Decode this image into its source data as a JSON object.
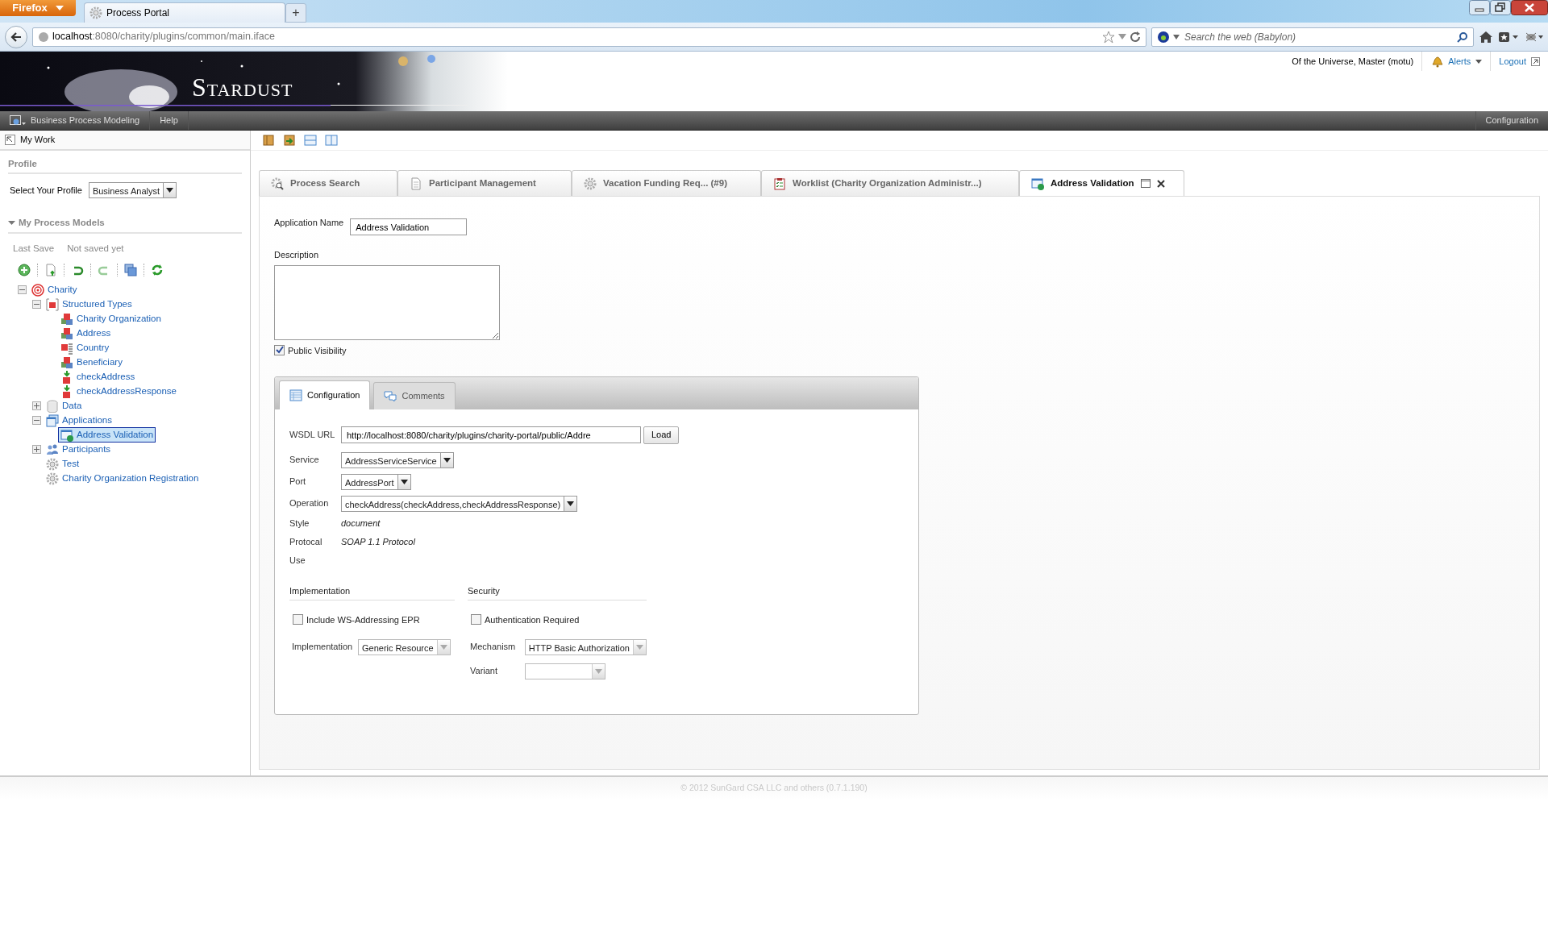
{
  "browser": {
    "menu_button": "Firefox",
    "tabs": [
      {
        "title": "Process Portal",
        "selected": true
      }
    ],
    "new_tab": "+",
    "url_host": "localhost",
    "url_rest": ":8080/charity/plugins/common/main.iface",
    "search_placeholder": "Search the web (Babylon)"
  },
  "header": {
    "logo": "Stardust",
    "user": "Of the Universe, Master (motu)",
    "alerts": "Alerts",
    "logout": "Logout"
  },
  "menubar": {
    "items": [
      "Business Process Modeling",
      "Help"
    ],
    "right": "Configuration"
  },
  "sidebar": {
    "title": "My Work",
    "profile_heading": "Profile",
    "profile_label": "Select Your Profile",
    "profile_value": "Business Analyst",
    "models_heading": "My Process Models",
    "models_expanded": true,
    "last_save_label": "Last Save",
    "last_save_value": "Not saved yet",
    "tree": [
      {
        "label": "Charity",
        "kind": "model",
        "expanded": true,
        "selected": false,
        "children": [
          {
            "label": "Structured Types",
            "kind": "types",
            "expanded": true,
            "selected": false,
            "children": [
              {
                "label": "Charity Organization",
                "kind": "struct",
                "selected": false
              },
              {
                "label": "Address",
                "kind": "struct",
                "selected": false
              },
              {
                "label": "Country",
                "kind": "enum",
                "selected": false
              },
              {
                "label": "Beneficiary",
                "kind": "struct",
                "selected": false
              },
              {
                "label": "checkAddress",
                "kind": "element",
                "selected": false
              },
              {
                "label": "checkAddressResponse",
                "kind": "element",
                "selected": false
              }
            ]
          },
          {
            "label": "Data",
            "kind": "data",
            "expanded": false,
            "selected": false
          },
          {
            "label": "Applications",
            "kind": "apps",
            "expanded": true,
            "selected": false,
            "children": [
              {
                "label": "Address Validation",
                "kind": "app",
                "selected": true
              }
            ]
          },
          {
            "label": "Participants",
            "kind": "participants",
            "expanded": false,
            "selected": false
          },
          {
            "label": "Test",
            "kind": "process",
            "selected": false
          },
          {
            "label": "Charity Organization Registration",
            "kind": "process",
            "selected": false
          }
        ]
      }
    ]
  },
  "tabs": [
    {
      "label": "Process Search",
      "kind": "search",
      "selected": false
    },
    {
      "label": "Participant Management",
      "kind": "document",
      "selected": false
    },
    {
      "label": "Vacation Funding Req... (#9)",
      "kind": "gear",
      "selected": false
    },
    {
      "label": "Worklist (Charity Organization Administr...)",
      "kind": "clipboard",
      "selected": false
    },
    {
      "label": "Address Validation",
      "kind": "app",
      "selected": true
    }
  ],
  "form": {
    "app_name_label": "Application Name",
    "app_name_value": "Address Validation",
    "description_label": "Description",
    "public_visibility": {
      "label": "Public Visibility",
      "checked": true
    }
  },
  "config": {
    "tabs": [
      {
        "label": "Configuration",
        "kind": "table",
        "selected": true
      },
      {
        "label": "Comments",
        "kind": "comments",
        "selected": false
      }
    ],
    "wsdl_label": "WSDL URL",
    "wsdl_value": "http://localhost:8080/charity/plugins/charity-portal/public/Addre",
    "load_button": "Load",
    "fields": [
      {
        "label": "Service",
        "kind": "select",
        "value": "AddressServiceService"
      },
      {
        "label": "Port",
        "kind": "select",
        "value": "AddressPort"
      },
      {
        "label": "Operation",
        "kind": "select",
        "value": "checkAddress(checkAddress,checkAddressResponse)"
      },
      {
        "label": "Style",
        "kind": "text",
        "value": "document"
      },
      {
        "label": "Protocal",
        "kind": "text",
        "value": "SOAP 1.1 Protocol"
      },
      {
        "label": "Use",
        "kind": "text"
      }
    ],
    "implementation": {
      "heading": "Implementation",
      "checkbox": {
        "label": "Include WS-Addressing EPR",
        "checked": false
      },
      "fields": [
        {
          "label": "Implementation",
          "value": "Generic Resource",
          "disabled": true
        }
      ]
    },
    "security": {
      "heading": "Security",
      "checkbox": {
        "label": "Authentication Required",
        "checked": false
      },
      "fields": [
        {
          "label": "Mechanism",
          "value": "HTTP Basic Authorization",
          "disabled": true
        },
        {
          "label": "Variant",
          "disabled": true
        }
      ]
    }
  },
  "footer": "© 2012 SunGard CSA LLC and others (0.7.1.190)"
}
